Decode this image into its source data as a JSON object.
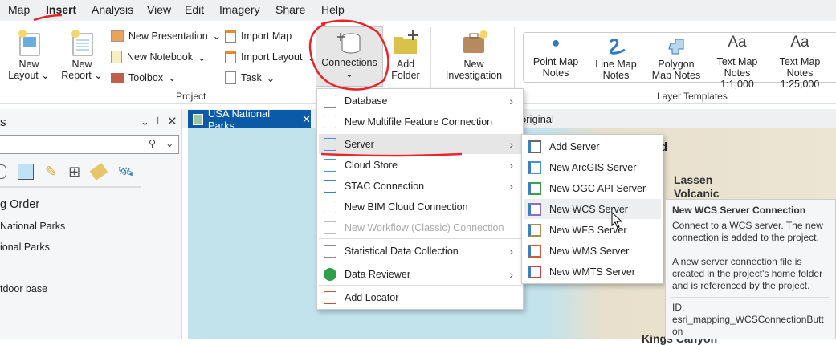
{
  "menubar": {
    "items": [
      "Map",
      "Insert",
      "Analysis",
      "View",
      "Edit",
      "Imagery",
      "Share",
      "Help"
    ]
  },
  "ribbon": {
    "new_layout": [
      "New",
      "Layout"
    ],
    "new_report": [
      "New",
      "Report"
    ],
    "new_presentation": "New Presentation",
    "new_notebook": "New Notebook",
    "toolbox": "Toolbox",
    "import_map": "Import Map",
    "import_layout": "Import Layout",
    "task": "Task",
    "connections": "Connections",
    "add_folder": [
      "Add",
      "Folder"
    ],
    "new_investigation": [
      "New",
      "Investigation"
    ],
    "project_group": "Project",
    "layer_templates": [
      [
        "Point Map",
        "Notes"
      ],
      [
        "Line Map",
        "Notes"
      ],
      [
        "Polygon",
        "Map Notes"
      ],
      [
        "Text Map",
        "Notes 1:1,000"
      ],
      [
        "Text Map",
        "Notes 1:25,000"
      ]
    ],
    "text_icon": "Aa",
    "layer_templates_group": "Layer Templates"
  },
  "pane": {
    "title": "s",
    "search": "",
    "drawing_order": "g Order",
    "layers": [
      "National Parks",
      "ional Parks",
      "tdoor base"
    ]
  },
  "map_tab": {
    "title": "USA National Parks",
    "other_tab": "original"
  },
  "map": {
    "labels": [
      "d",
      "Lassen",
      "Volcanic",
      "Kings Canyon"
    ]
  },
  "connections_menu": [
    {
      "label": "Database",
      "sub": true
    },
    {
      "label": "New Multifile Feature Connection"
    },
    {
      "label": "Server",
      "sub": true,
      "active": true
    },
    {
      "label": "Cloud Store",
      "sub": true
    },
    {
      "label": "STAC Connection",
      "sub": true
    },
    {
      "label": "New BIM Cloud Connection"
    },
    {
      "label": "New Workflow (Classic) Connection",
      "disabled": true
    },
    {
      "label": "Statistical Data Collection",
      "sub": true
    },
    {
      "label": "Data Reviewer",
      "sub": true
    },
    {
      "label": "Add Locator"
    }
  ],
  "server_menu": [
    "Add Server",
    "New ArcGIS Server",
    "New OGC API Server",
    "New WCS Server",
    "New WFS Server",
    "New WMS Server",
    "New WMTS Server"
  ],
  "server_icon_colors": [
    "#666666",
    "#4a90d9",
    "#3aa04a",
    "#8a6fc0",
    "#b08a50",
    "#d05a3a",
    "#d04040"
  ],
  "tooltip": {
    "title": "New WCS Server Connection",
    "p1": "Connect to a WCS server. The new connection is added to the project.",
    "p2": "A new server connection file is created in the project's home folder and is referenced by the project.",
    "id_label": "ID:",
    "id_value": "esri_mapping_WCSConnectionButton"
  },
  "annotation_color": "#e8262a"
}
